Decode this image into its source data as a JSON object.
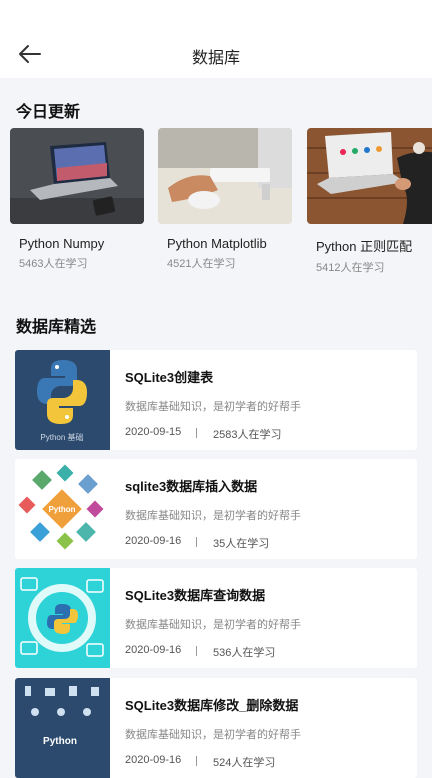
{
  "header": {
    "title": "数据库",
    "back_icon": "back-arrow-icon"
  },
  "today": {
    "section_title": "今日更新",
    "items": [
      {
        "name": "Python Numpy",
        "learners": "5463人在学习"
      },
      {
        "name": "Python Matplotlib",
        "learners": "4521人在学习"
      },
      {
        "name": "Python 正则匹配",
        "learners": "5412人在学习"
      }
    ]
  },
  "featured": {
    "section_title": "数据库精选",
    "items": [
      {
        "title": "SQLite3创建表",
        "desc": "数据库基础知识，是初学者的好帮手",
        "date": "2020-09-15",
        "learners": "2583人在学习",
        "thumb_text": "Python 基础"
      },
      {
        "title": "sqlite3数据库插入数据",
        "desc": "数据库基础知识，是初学者的好帮手",
        "date": "2020-09-16",
        "learners": "35人在学习",
        "thumb_text": "Python"
      },
      {
        "title": "SQLite3数据库查询数据",
        "desc": "数据库基础知识，是初学者的好帮手",
        "date": "2020-09-16",
        "learners": "536人在学习",
        "thumb_text": ""
      },
      {
        "title": "SQLite3数据库修改_删除数据",
        "desc": "数据库基础知识，是初学者的好帮手",
        "date": "2020-09-16",
        "learners": "524人在学习",
        "thumb_text": "Python"
      }
    ]
  },
  "colors": {
    "background": "#f4f5f9",
    "card": "#ffffff",
    "thumb_navy": "#2b4a6e",
    "thumb_teal": "#2ed3d8",
    "python_blue": "#3a78b5",
    "python_yellow": "#f3c53b"
  }
}
